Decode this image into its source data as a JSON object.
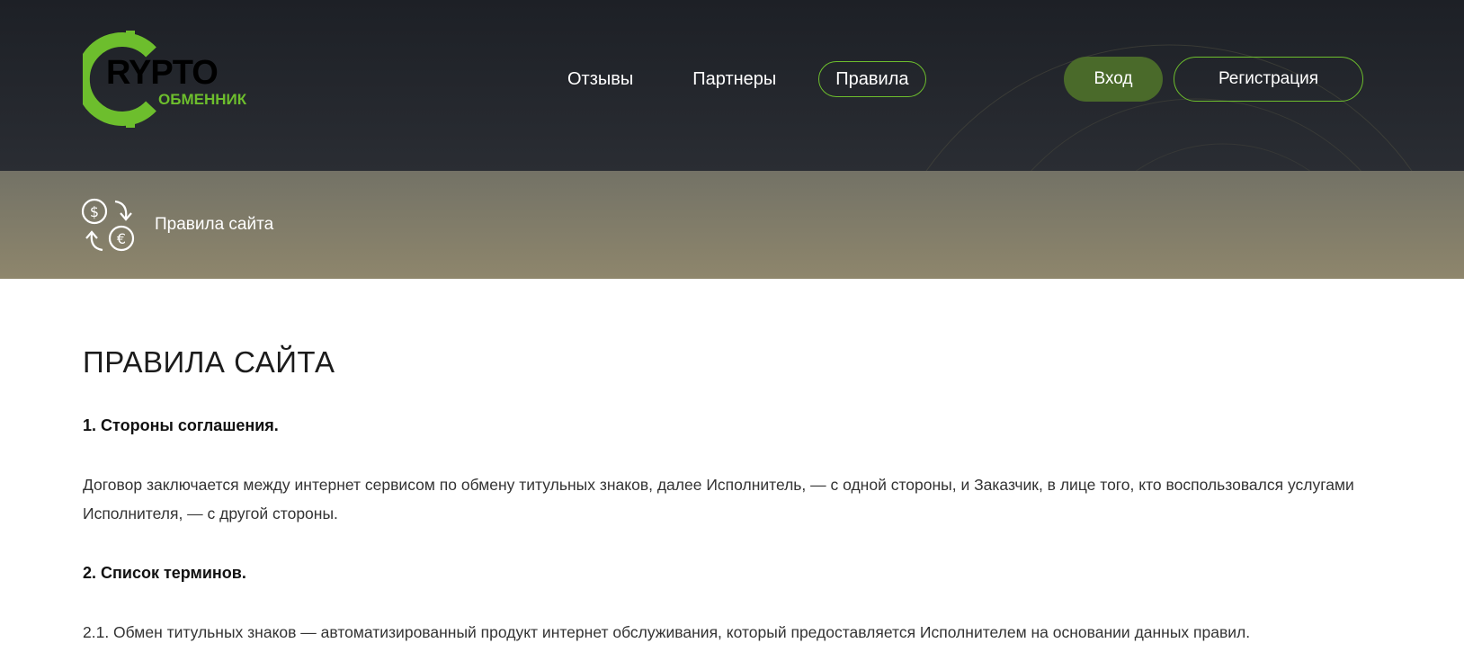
{
  "header": {
    "logo": {
      "word": "RYPTO",
      "sub": "ОБМЕННИК"
    },
    "nav": [
      {
        "label": "Отзывы",
        "active": false
      },
      {
        "label": "Партнеры",
        "active": false
      },
      {
        "label": "Правила",
        "active": true
      }
    ],
    "login_label": "Вход",
    "register_label": "Регистрация"
  },
  "banner": {
    "title": "Правила сайта",
    "icon": "currency-exchange-icon"
  },
  "main": {
    "page_title": "ПРАВИЛА САЙТА",
    "sections": [
      {
        "title": "1. Стороны соглашения."
      },
      {
        "text": "Договор заключается между интернет сервисом по обмену титульных знаков, далее Исполнитель, — с одной стороны, и Заказчик, в лице того, кто воспользовался услугами Исполнителя, — с другой стороны."
      },
      {
        "title": "2. Список терминов."
      },
      {
        "text": "2.1. Обмен титульных знаков — автоматизированный продукт интернет обслуживания, который предоставляется Исполнителем на основании данных правил."
      }
    ]
  },
  "colors": {
    "accent": "#6dbe2d",
    "header_bg": "#1d2026",
    "login_bg": "#4a6a2a",
    "banner_bg": "#8e866c"
  }
}
